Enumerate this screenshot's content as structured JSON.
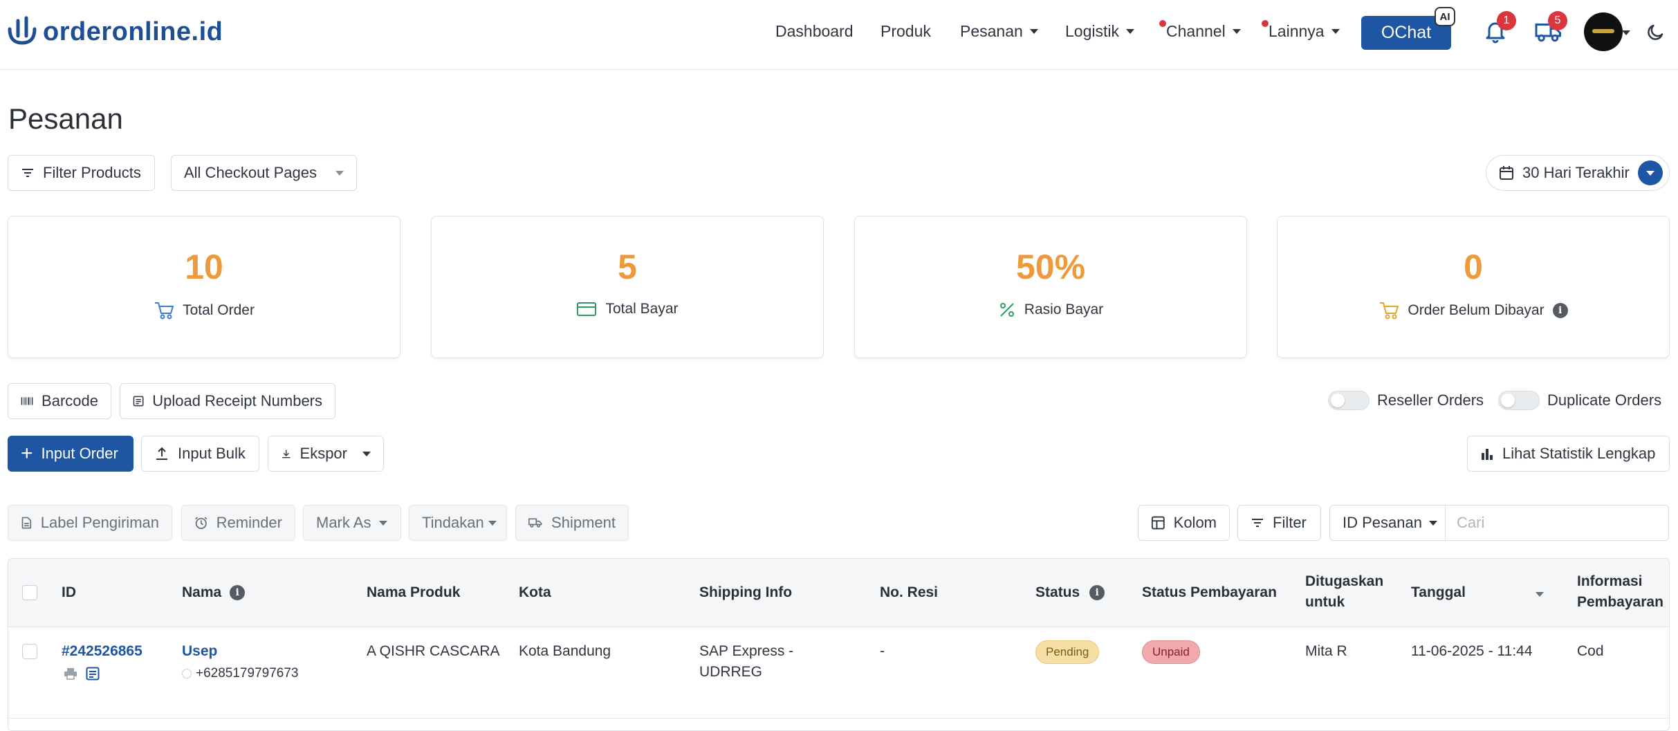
{
  "brand": {
    "name": "orderonline.id",
    "color": "#1f4f93"
  },
  "nav": {
    "dashboard": "Dashboard",
    "produk": "Produk",
    "pesanan": "Pesanan",
    "logistik": "Logistik",
    "channel": "Channel",
    "lainnya": "Lainnya",
    "ochat": "OChat",
    "ai_badge": "AI",
    "notif_count": "1",
    "shipping_count": "5"
  },
  "page": {
    "title": "Pesanan"
  },
  "filters": {
    "filter_products": "Filter Products",
    "checkout_pages": "All Checkout Pages",
    "date_range": "30 Hari Terakhir"
  },
  "stats": [
    {
      "value": "10",
      "label": "Total Order",
      "icon": "cart-icon"
    },
    {
      "value": "5",
      "label": "Total Bayar",
      "icon": "credit-card-icon"
    },
    {
      "value": "50%",
      "label": "Rasio Bayar",
      "icon": "percent-icon"
    },
    {
      "value": "0",
      "label": "Order Belum Dibayar",
      "icon": "cart-icon"
    }
  ],
  "tools": {
    "barcode": "Barcode",
    "upload_receipt": "Upload Receipt Numbers",
    "reseller_orders": "Reseller Orders",
    "duplicate_orders": "Duplicate Orders"
  },
  "actions": {
    "input_order": "Input Order",
    "input_bulk": "Input Bulk",
    "ekspor": "Ekspor",
    "lihat_statistik": "Lihat Statistik Lengkap"
  },
  "bulk": {
    "label_pengiriman": "Label Pengiriman",
    "reminder": "Reminder",
    "mark_as": "Mark As",
    "tindakan": "Tindakan",
    "shipment": "Shipment",
    "kolom": "Kolom",
    "filter": "Filter",
    "search_field": "ID Pesanan",
    "search_placeholder": "Cari"
  },
  "table": {
    "headers": {
      "id": "ID",
      "nama": "Nama",
      "nama_produk": "Nama Produk",
      "kota": "Kota",
      "shipping_info": "Shipping Info",
      "no_resi": "No. Resi",
      "status": "Status",
      "status_pembayaran": "Status Pembayaran",
      "ditugaskan_1": "Ditugaskan",
      "ditugaskan_2": "untuk",
      "tanggal": "Tanggal",
      "informasi_1": "Informasi",
      "informasi_2": "Pembayaran"
    },
    "rows": [
      {
        "id": "#242526865",
        "nama": "Usep",
        "phone": "+6285179797673",
        "produk": "A QISHR CASCARA",
        "kota": "Kota Bandung",
        "shipping_1": "SAP Express -",
        "shipping_2": "UDRREG",
        "resi": "-",
        "status": "Pending",
        "pembayaran": "Unpaid",
        "ditugaskan": "Mita R",
        "tanggal": "11-06-2025 - 11:44",
        "informasi": "Cod"
      }
    ]
  },
  "colors": {
    "primary": "#1f56a3",
    "stat_value": "#ec9a3c",
    "badge_red": "#d9363e",
    "pending_bg": "#f6dfa4",
    "unpaid_bg": "#f1a9ab"
  }
}
